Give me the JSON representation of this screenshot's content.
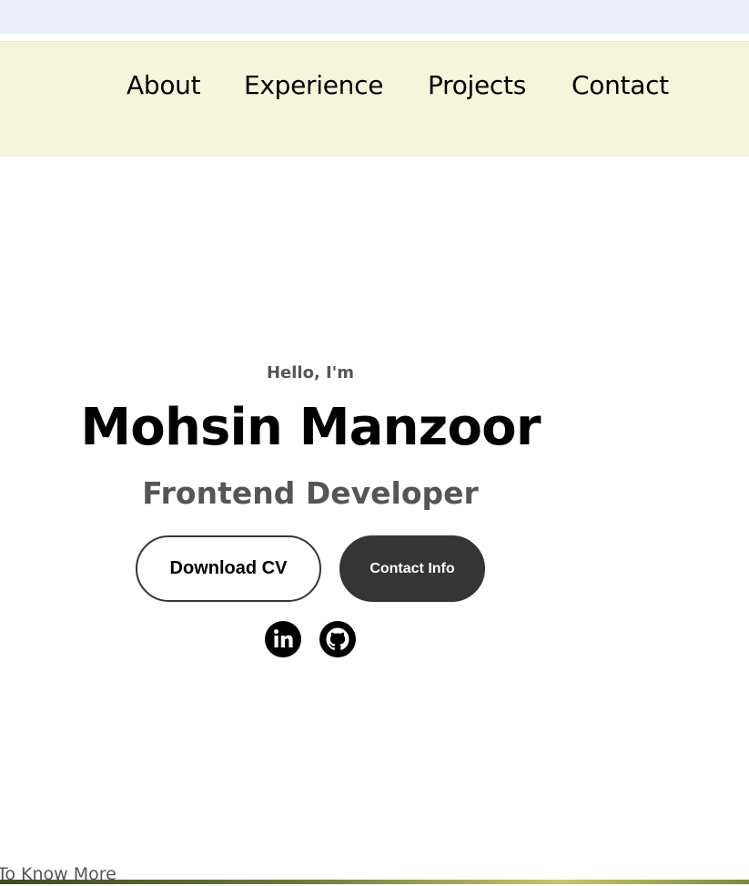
{
  "nav": {
    "links": [
      {
        "label": "About"
      },
      {
        "label": "Experience"
      },
      {
        "label": "Projects"
      },
      {
        "label": "Contact"
      }
    ]
  },
  "hero": {
    "greeting": "Hello, I'm",
    "name": "Mohsin Manzoor",
    "role": "Frontend Developer",
    "download_cv_label": "Download CV",
    "contact_info_label": "Contact Info"
  },
  "social": {
    "linkedin_icon": "linkedin-icon",
    "github_icon": "github-icon"
  },
  "footer_hint": {
    "text": "To Know More"
  },
  "colors": {
    "navbar_bg": "#f5f5dc",
    "browser_strip": "#ebeef7",
    "dark_button": "#353535",
    "muted_text": "#555555"
  }
}
